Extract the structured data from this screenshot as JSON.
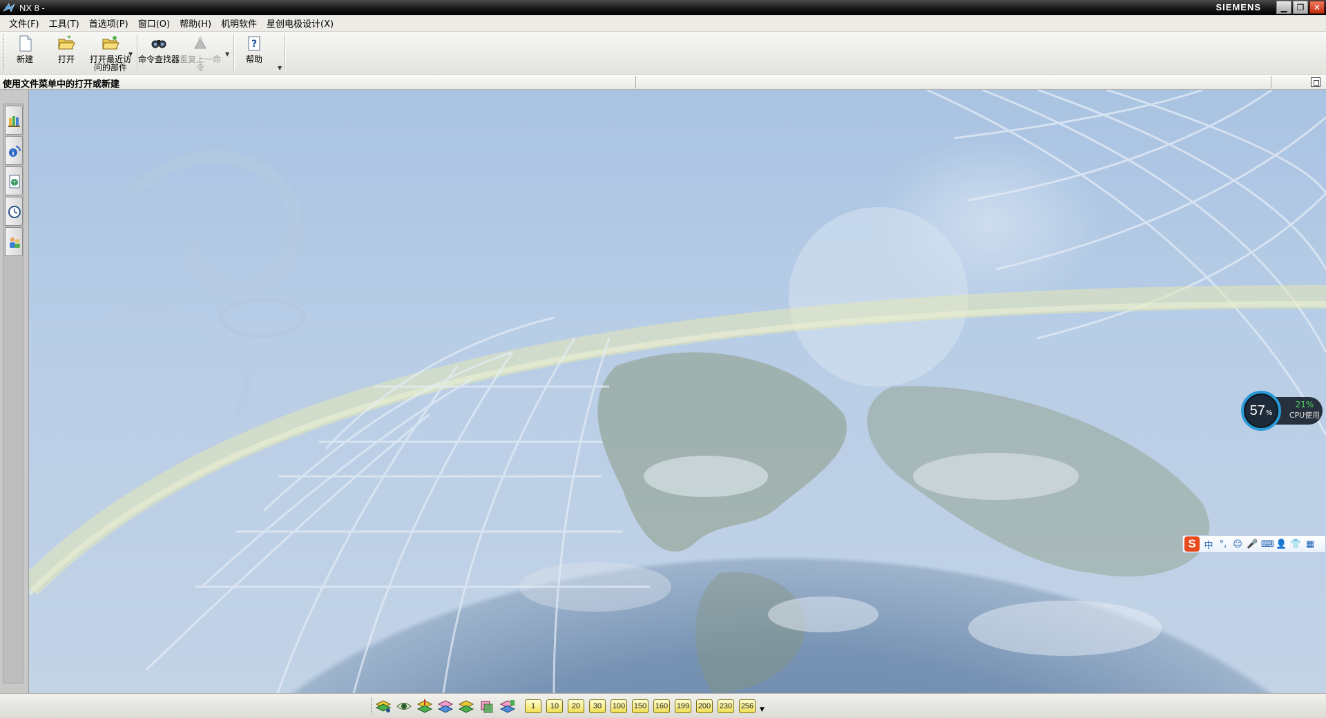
{
  "titlebar": {
    "title": "NX 8 -",
    "brand": "SIEMENS",
    "minimize_icon": "minimize-icon",
    "restore_icon": "restore-icon",
    "close_icon": "close-icon"
  },
  "menubar": {
    "items": [
      {
        "label": "文件(F)"
      },
      {
        "label": "工具(T)"
      },
      {
        "label": "首选项(P)"
      },
      {
        "label": "窗口(O)"
      },
      {
        "label": "帮助(H)"
      },
      {
        "label": "机明软件"
      },
      {
        "label": "星创电极设计(X)"
      }
    ]
  },
  "toolbar": {
    "new_label": "新建",
    "open_label": "打开",
    "recent_label": "打开最近访问的部件",
    "finder_label": "命令查找器",
    "repeat_label": "重复上一命令",
    "help_label": "帮助"
  },
  "cueline": {
    "text": "使用文件菜单中的打开或新建"
  },
  "resource_bar": {
    "items": [
      {
        "icon": "assembly-navigator-icon"
      },
      {
        "icon": "info-feed-icon"
      },
      {
        "icon": "web-browser-icon"
      },
      {
        "icon": "history-icon"
      },
      {
        "icon": "roles-icon"
      }
    ]
  },
  "cpu_widget": {
    "percent": "57",
    "percent_sign": "%",
    "usage": "21%",
    "label": "CPU使用"
  },
  "ime": {
    "logo": "S",
    "items": [
      "中",
      "°,",
      "☺",
      "🎤",
      "⌨",
      "👤",
      "👕",
      "▦"
    ]
  },
  "layers": {
    "numbers": [
      "1",
      "10",
      "20",
      "30",
      "100",
      "150",
      "160",
      "199",
      "200",
      "230",
      "256"
    ]
  },
  "colors": {
    "titlebar": "#141414",
    "accent_blue": "#2b9ad8",
    "ime_red": "#e8491d"
  }
}
